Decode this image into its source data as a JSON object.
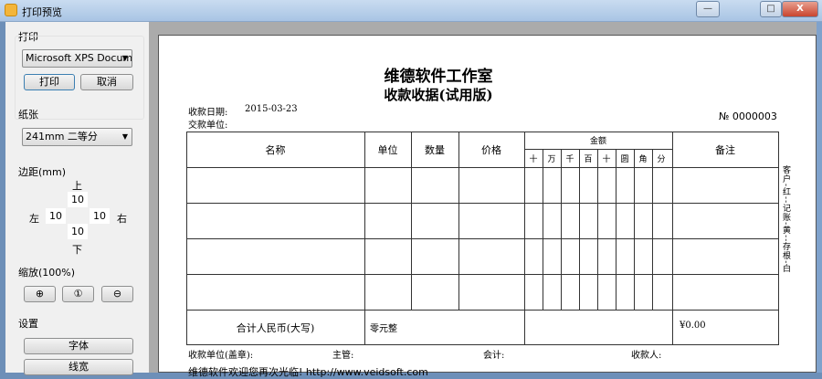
{
  "window": {
    "title": "打印预览",
    "min": "—",
    "max": "□",
    "close": "X"
  },
  "sidebar": {
    "print_group": "打印",
    "printer": "Microsoft XPS Document Writer",
    "print_btn": "打印",
    "cancel_btn": "取消",
    "paper_group": "纸张",
    "paper": "241mm 二等分",
    "margin_group": "边距(mm)",
    "top_label": "上",
    "bottom_label": "下",
    "left_label": "左",
    "right_label": "右",
    "margin_top": "10",
    "margin_bottom": "10",
    "margin_left": "10",
    "margin_right": "10",
    "zoom_group": "缩放(100%)",
    "settings_group": "设置",
    "font_btn": "字体",
    "linewidth_btn": "线宽"
  },
  "receipt": {
    "company": "维德软件工作室",
    "title": "收款收据(试用版)",
    "date_label": "收款日期:",
    "date": "2015-03-23",
    "payer_label": "交款单位:",
    "number": "№ 0000003",
    "headers": {
      "name": "名称",
      "unit": "单位",
      "qty": "数量",
      "price": "价格",
      "amount": "金额",
      "note": "备注"
    },
    "digits": [
      "十",
      "万",
      "千",
      "百",
      "十",
      "圆",
      "角",
      "分"
    ],
    "total_label": "合计人民币(大写)",
    "total_words": "零元整",
    "total_amount": "¥0.00",
    "side_note": "客户-红--记账-黄--存根-白",
    "footer": {
      "payee": "收款单位(盖章):",
      "supervisor": "主管:",
      "accountant": "会计:",
      "receiver": "收款人:"
    },
    "promo": "维德软件欢迎您再次光临!  http://www.veidsoft.com"
  }
}
